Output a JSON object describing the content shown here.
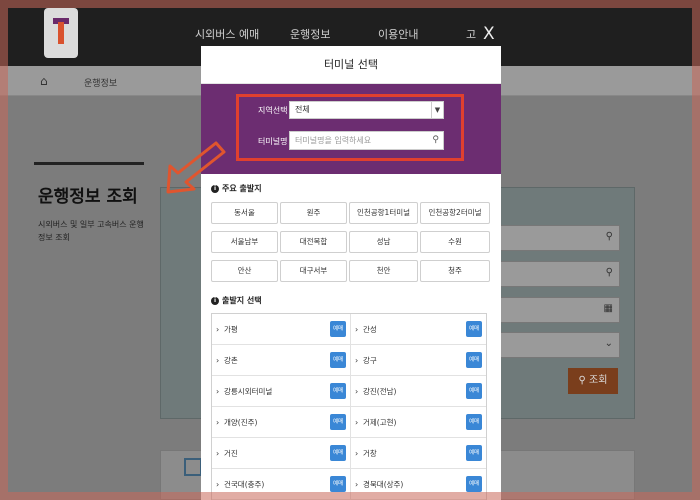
{
  "background": {
    "nav": [
      "시외버스 예매",
      "운행정보",
      "이용안내",
      "고"
    ],
    "breadcrumb": "운행정보",
    "page_title": "운행정보 조회",
    "page_desc": "시외버스 및 일부 고속버스 운행정보 조회",
    "search_button": "조회"
  },
  "modal": {
    "title": "터미널 선택",
    "close": "X",
    "region_label": "지역선택",
    "region_value": "전체",
    "terminal_label": "터미널명",
    "terminal_placeholder": "터미널명을 입력하세요",
    "major_section": "주요 출발지",
    "major": [
      "동서울",
      "원주",
      "인천공항1터미널",
      "인천공항2터미널",
      "서울남부",
      "대전복합",
      "성남",
      "수원",
      "안산",
      "대구서부",
      "천안",
      "청주"
    ],
    "start_section": "출발지 선택",
    "reserve_label": "예매",
    "left_list": [
      "가평",
      "강촌",
      "강릉시외터미널",
      "개양(진주)",
      "거진",
      "건국대(충주)"
    ],
    "right_list": [
      "간성",
      "강구",
      "강진(전남)",
      "거제(고현)",
      "거창",
      "경북대(상주)"
    ]
  },
  "colors": {
    "purple": "#6c2d71",
    "highlight": "#e0402e",
    "reserve": "#3a87d6",
    "search": "#7a3e1c"
  }
}
